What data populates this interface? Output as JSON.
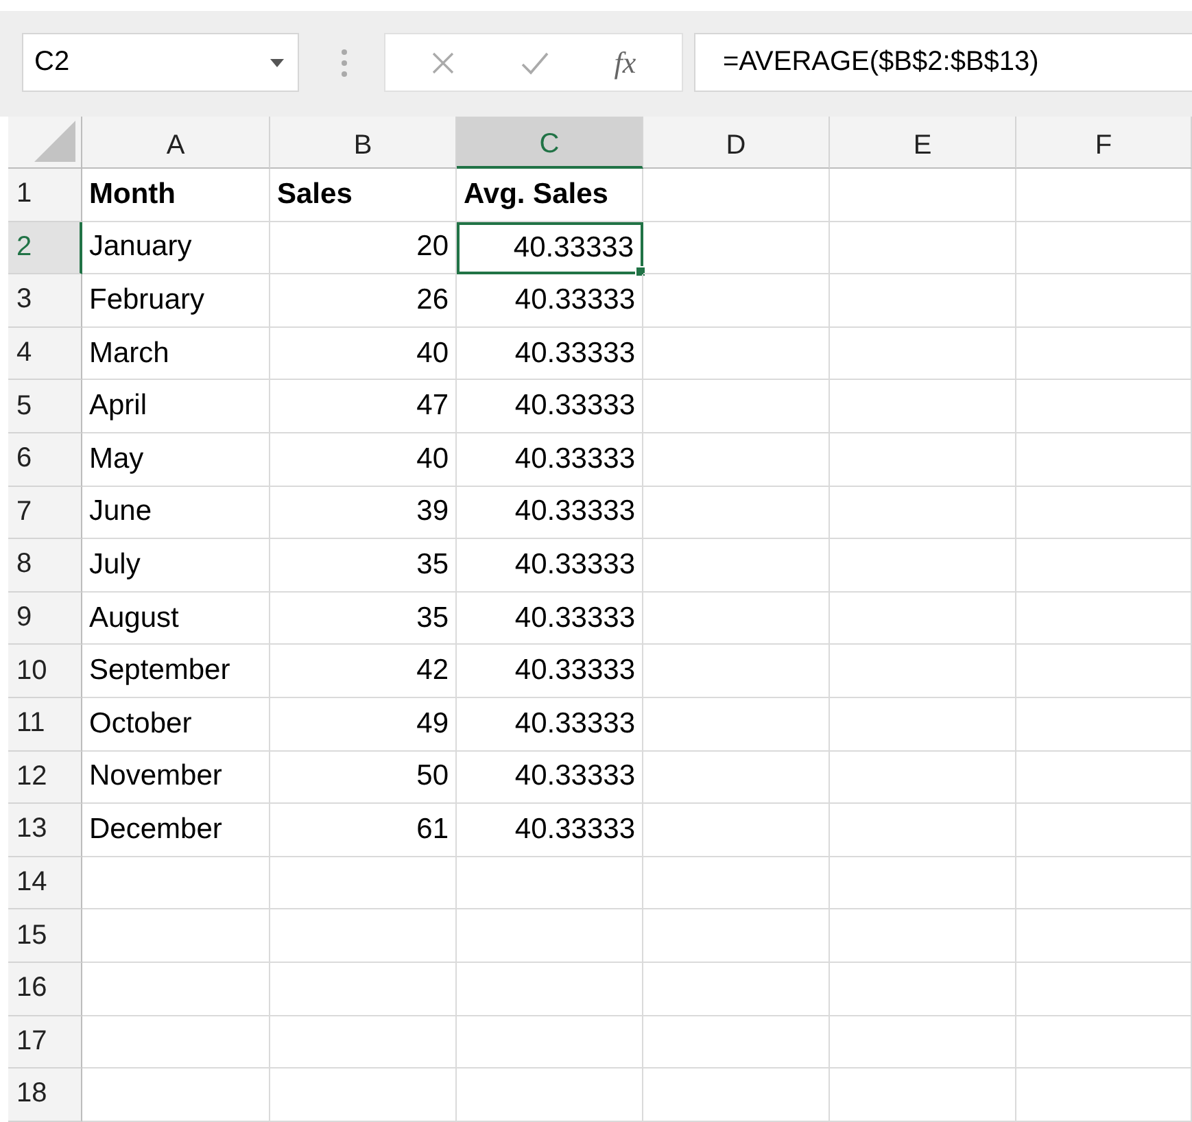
{
  "name_box": {
    "value": "C2"
  },
  "formula_bar": {
    "function_label": "fx",
    "value": "=AVERAGE($B$2:$B$13)"
  },
  "columns": [
    {
      "label": "A",
      "selected": false
    },
    {
      "label": "B",
      "selected": false
    },
    {
      "label": "C",
      "selected": true
    },
    {
      "label": "D",
      "selected": false
    },
    {
      "label": "E",
      "selected": false
    },
    {
      "label": "F",
      "selected": false
    }
  ],
  "rows": [
    {
      "header": "1",
      "selected": false,
      "cells": [
        {
          "value": "Month",
          "kind": "heading",
          "selected": false
        },
        {
          "value": "Sales",
          "kind": "heading",
          "selected": false
        },
        {
          "value": "Avg. Sales",
          "kind": "heading",
          "selected": false
        }
      ]
    },
    {
      "header": "2",
      "selected": true,
      "cells": [
        {
          "value": "January",
          "kind": "label",
          "selected": false
        },
        {
          "value": "20",
          "kind": "number",
          "selected": false
        },
        {
          "value": "40.33333",
          "kind": "number",
          "selected": true
        }
      ]
    },
    {
      "header": "3",
      "selected": false,
      "cells": [
        {
          "value": "February",
          "kind": "label",
          "selected": false
        },
        {
          "value": "26",
          "kind": "number",
          "selected": false
        },
        {
          "value": "40.33333",
          "kind": "number",
          "selected": false
        }
      ]
    },
    {
      "header": "4",
      "selected": false,
      "cells": [
        {
          "value": "March",
          "kind": "label",
          "selected": false
        },
        {
          "value": "40",
          "kind": "number",
          "selected": false
        },
        {
          "value": "40.33333",
          "kind": "number",
          "selected": false
        }
      ]
    },
    {
      "header": "5",
      "selected": false,
      "cells": [
        {
          "value": "April",
          "kind": "label",
          "selected": false
        },
        {
          "value": "47",
          "kind": "number",
          "selected": false
        },
        {
          "value": "40.33333",
          "kind": "number",
          "selected": false
        }
      ]
    },
    {
      "header": "6",
      "selected": false,
      "cells": [
        {
          "value": "May",
          "kind": "label",
          "selected": false
        },
        {
          "value": "40",
          "kind": "number",
          "selected": false
        },
        {
          "value": "40.33333",
          "kind": "number",
          "selected": false
        }
      ]
    },
    {
      "header": "7",
      "selected": false,
      "cells": [
        {
          "value": "June",
          "kind": "label",
          "selected": false
        },
        {
          "value": "39",
          "kind": "number",
          "selected": false
        },
        {
          "value": "40.33333",
          "kind": "number",
          "selected": false
        }
      ]
    },
    {
      "header": "8",
      "selected": false,
      "cells": [
        {
          "value": "July",
          "kind": "label",
          "selected": false
        },
        {
          "value": "35",
          "kind": "number",
          "selected": false
        },
        {
          "value": "40.33333",
          "kind": "number",
          "selected": false
        }
      ]
    },
    {
      "header": "9",
      "selected": false,
      "cells": [
        {
          "value": "August",
          "kind": "label",
          "selected": false
        },
        {
          "value": "35",
          "kind": "number",
          "selected": false
        },
        {
          "value": "40.33333",
          "kind": "number",
          "selected": false
        }
      ]
    },
    {
      "header": "10",
      "selected": false,
      "cells": [
        {
          "value": "September",
          "kind": "label",
          "selected": false
        },
        {
          "value": "42",
          "kind": "number",
          "selected": false
        },
        {
          "value": "40.33333",
          "kind": "number",
          "selected": false
        }
      ]
    },
    {
      "header": "11",
      "selected": false,
      "cells": [
        {
          "value": "October",
          "kind": "label",
          "selected": false
        },
        {
          "value": "49",
          "kind": "number",
          "selected": false
        },
        {
          "value": "40.33333",
          "kind": "number",
          "selected": false
        }
      ]
    },
    {
      "header": "12",
      "selected": false,
      "cells": [
        {
          "value": "November",
          "kind": "label",
          "selected": false
        },
        {
          "value": "50",
          "kind": "number",
          "selected": false
        },
        {
          "value": "40.33333",
          "kind": "number",
          "selected": false
        }
      ]
    },
    {
      "header": "13",
      "selected": false,
      "cells": [
        {
          "value": "December",
          "kind": "label",
          "selected": false
        },
        {
          "value": "61",
          "kind": "number",
          "selected": false
        },
        {
          "value": "40.33333",
          "kind": "number",
          "selected": false
        }
      ]
    },
    {
      "header": "14",
      "selected": false
    },
    {
      "header": "15",
      "selected": false
    },
    {
      "header": "16",
      "selected": false
    },
    {
      "header": "17",
      "selected": false
    },
    {
      "header": "18",
      "selected": false
    }
  ]
}
